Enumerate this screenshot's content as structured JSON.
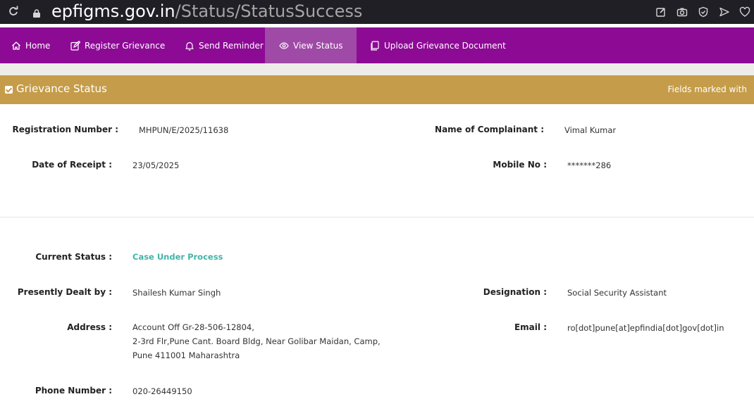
{
  "browser": {
    "url_domain": "epfigms.gov.in",
    "url_path": "/Status/StatusSuccess"
  },
  "nav": [
    {
      "label": "Home",
      "icon": "home-icon"
    },
    {
      "label": "Register Grievance",
      "icon": "edit-icon"
    },
    {
      "label": "Send Reminder",
      "icon": "bell-icon"
    },
    {
      "label": "View Status",
      "icon": "eye-icon",
      "active": true
    },
    {
      "label": "Upload Grievance Document",
      "icon": "document-icon"
    }
  ],
  "header": {
    "title": "Grievance Status",
    "note": "Fields marked with"
  },
  "fields": {
    "registration_number_label": "Registration Number :",
    "registration_number": "MHPUN/E/2025/11638",
    "complainant_label": "Name of Complainant :",
    "complainant": "Vimal Kumar",
    "receipt_date_label": "Date of Receipt :",
    "receipt_date": "23/05/2025",
    "mobile_label": "Mobile No :",
    "mobile": "*******286",
    "current_status_label": "Current Status :",
    "current_status": "Case Under Process",
    "dealt_by_label": "Presently Dealt by :",
    "dealt_by": "Shailesh Kumar Singh",
    "designation_label": "Designation :",
    "designation": "Social Security Assistant",
    "address_label": "Address :",
    "address_lines": [
      "Account Off Gr-28-506-12804,",
      "2-3rd Flr,Pune Cant. Board Bldg, Near Golibar Maidan, Camp,",
      "Pune 411001 Maharashtra"
    ],
    "email_label": "Email :",
    "email": "ro[dot]pune[at]epfindia[dot]gov[dot]in",
    "phone_label": "Phone Number :",
    "phone": "020-26449150"
  },
  "colors": {
    "nav_bg": "#8d0a95",
    "nav_active": "#9f4aa6",
    "header_bg": "#c59c49",
    "status_text": "#42b5a7"
  }
}
